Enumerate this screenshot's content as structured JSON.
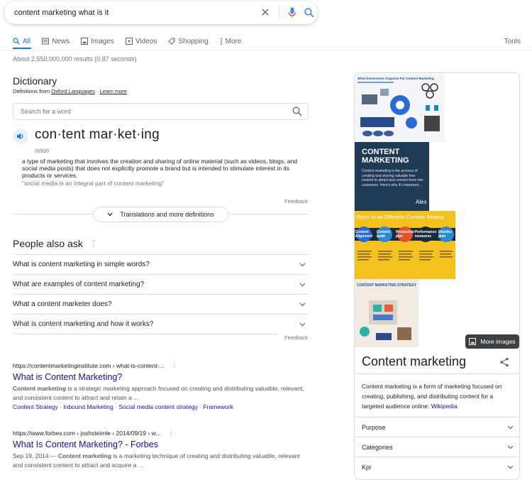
{
  "search": {
    "query": "content marketing what is it"
  },
  "tabs": [
    {
      "label": "All",
      "icon": "search-icon"
    },
    {
      "label": "News",
      "icon": "news-icon"
    },
    {
      "label": "Images",
      "icon": "image-icon"
    },
    {
      "label": "Videos",
      "icon": "video-icon"
    },
    {
      "label": "Shopping",
      "icon": "tag-icon"
    },
    {
      "label": "More",
      "icon": "more-vert-icon"
    }
  ],
  "tools_label": "Tools",
  "stats": "About 2,550,000,000 results (0.87 seconds)",
  "dictionary": {
    "title": "Dictionary",
    "source_prefix": "Definitions from",
    "source_name": "Oxford Languages",
    "learn_more": "Learn more",
    "search_placeholder": "Search for a word",
    "word": "con·tent mar·ket·ing",
    "part_of_speech": "noun",
    "definition": "a type of marketing that involves the creation and sharing of online material (such as videos, blogs, and social media posts) that does not explicitly promote a brand but is intended to stimulate interest in its products or services.",
    "example": "\"social media is an integral part of content marketing\"",
    "feedback": "Feedback",
    "more_button": "Translations and more definitions"
  },
  "paa": {
    "title": "People also ask",
    "questions": [
      "What is content marketing in simple words?",
      "What are examples of content marketing?",
      "What a content marketer does?",
      "What is content marketing and how it works?"
    ],
    "feedback": "Feedback"
  },
  "results": [
    {
      "url": "https://contentmarketinginstitute.com › what-is-content-...",
      "title": "What is Content Marketing?",
      "snippet_bold": "Content marketing",
      "snippet": " is a strategic marketing approach focused on creating and distributing valuable, relevant, and consistent content to attract and retain a ...",
      "links": [
        "Content Strategy",
        "Inbound Marketing",
        "Social media content strategy",
        "Framework"
      ]
    },
    {
      "url": "https://www.forbes.com › joshsteimle › 2014/09/19 › w...",
      "title": "What Is Content Marketing? - Forbes",
      "date": "Sep 19, 2014 —",
      "snippet_bold": "Content marketing",
      "snippet": " is a marketing technique of creating and distributing valuable, relevant and consistent content to attract and acquire a ..."
    }
  ],
  "knowledge_panel": {
    "img1_title": "What Dimensions Organize Pur Content Marketing",
    "img2_title": "CONTENT MARKETING",
    "img2_text": "Content marketing is the process of creating and sharing valuable free content to attract and convert them into customers. Here's why it's important...",
    "img2_brand": "Alex",
    "img3_title": "Steps to an Effective Content Strateg",
    "img3_steps": [
      "Content Alignment",
      "Content audit",
      "Production plan",
      "Performance measures",
      "Distribu plan"
    ],
    "img4_title": "CONTENT MARKETING STRATEGY",
    "more_images": "More images",
    "title": "Content marketing",
    "description": "Content marketing is a form of marketing focused on creating, publishing, and distributing content for a targeted audience online.",
    "description_link": "Wikipedia",
    "rows": [
      "Purpose",
      "Categories",
      "Kpi"
    ]
  },
  "colors": {
    "accent": "#1a73e8",
    "link": "#1a0dab",
    "text": "#202124",
    "muted": "#70757a"
  }
}
